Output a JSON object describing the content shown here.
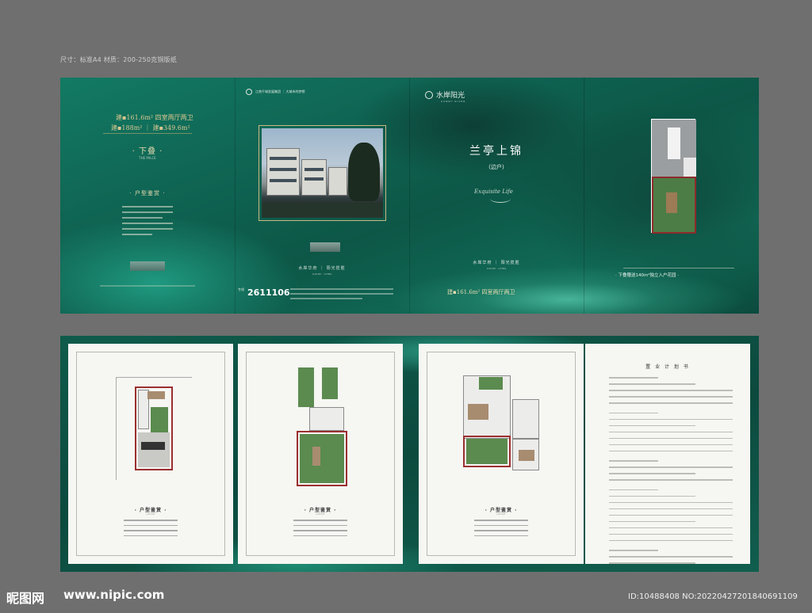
{
  "spec_line": "尺寸：标准A4 材质：200-250克铜版纸",
  "cover": {
    "size_line_1": "建▪161.6m² 四室两厅两卫",
    "size_line_2": "建▪188m² ｜ 建▪349.6m²",
    "house_type": "· 下叠 ·",
    "house_type_en": "THE PALCE",
    "layout_title": "· 户型鉴赏 ·"
  },
  "panel2": {
    "logo_text": "江南千城发展集团 ｜ 大城市的梦想",
    "slogan": "水岸华府 ｜ 阳光揽胜",
    "slogan_sub": "LUXURY · LIVING",
    "tel_prefix": "专线",
    "tel": "2611106"
  },
  "panel3": {
    "brand": "水岸阳光",
    "brand_sub": "SUNNY RIVER",
    "title": "兰亭上锦",
    "subtitle": "(边户)",
    "script": "Exquisite Life",
    "slogan": "水岸华府 ｜ 阳光揽胜",
    "slogan_sub": "LUXURY · LIVING",
    "size": "建▪161.6m² 四室两厅两卫"
  },
  "panel4": {
    "caption": "· 下叠赠送140m²独立入户花园 ·"
  },
  "pages": [
    {
      "title": "· 户型鉴赏 ·",
      "title_en": "LAYOUT"
    },
    {
      "title": "· 户型鉴赏 ·",
      "title_en": "LAYOUT"
    },
    {
      "title": "· 户型鉴赏 ·",
      "title_en": "LAYOUT"
    }
  ],
  "form": {
    "title": "置 业 计 划 书"
  },
  "watermark": {
    "site_logo": "昵图网",
    "url": "www.nipic.com",
    "id": "ID:10488408 NO:20220427201840691109"
  }
}
